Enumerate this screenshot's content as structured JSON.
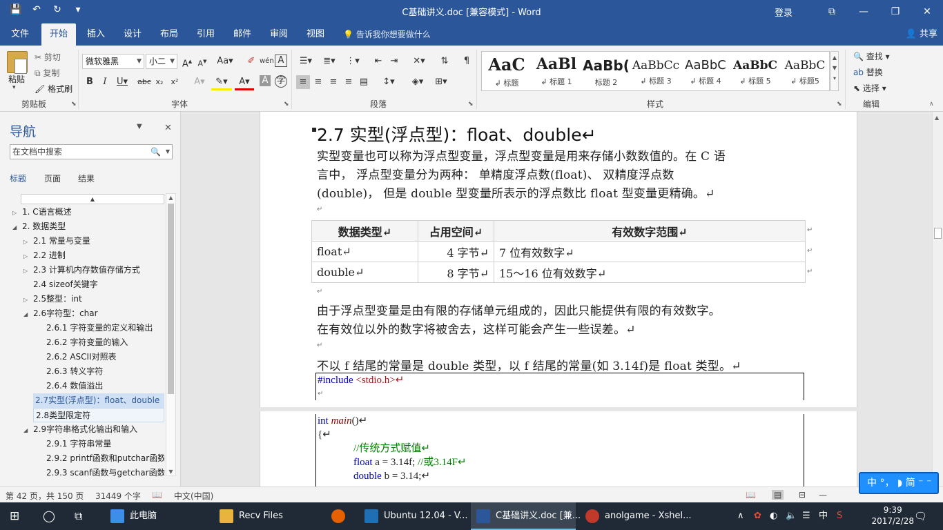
{
  "window": {
    "title": "C基础讲义.doc [兼容模式]  -  Word",
    "login": "登录",
    "restore_icon": "⧉",
    "minimize_icon": "—",
    "maximize_icon": "❐",
    "close_icon": "✕"
  },
  "qat": {
    "save": "💾",
    "undo": "↶",
    "redo": "↻",
    "customize": "▾"
  },
  "tabs": [
    "文件",
    "开始",
    "插入",
    "设计",
    "布局",
    "引用",
    "邮件",
    "审阅",
    "视图"
  ],
  "tell_me": "告诉我你想要做什么",
  "share": "共享",
  "clipboard": {
    "paste": "粘贴",
    "cut": "剪切",
    "copy": "复制",
    "format_painter": "格式刷",
    "label": "剪贴板"
  },
  "font": {
    "name": "微软雅黑",
    "size": "小二",
    "label": "字体"
  },
  "paragraph": {
    "label": "段落"
  },
  "styles": {
    "label": "样式",
    "items": [
      {
        "preview": "AaC",
        "name": "↲ 标题"
      },
      {
        "preview": "AaBl",
        "name": "↲ 标题 1"
      },
      {
        "preview": "AaBb(",
        "name": "标题 2"
      },
      {
        "preview": "AaBbCc",
        "name": "↲ 标题 3"
      },
      {
        "preview": "AaBbC",
        "name": "↲ 标题 4"
      },
      {
        "preview": "AaBbC",
        "name": "↲ 标题 5"
      },
      {
        "preview": "AaBbC",
        "name": "↲ 标题5"
      }
    ]
  },
  "editing": {
    "find": "查找",
    "replace": "替换",
    "select": "选择",
    "label": "编辑"
  },
  "nav": {
    "title": "导航",
    "search_placeholder": "在文档中搜索",
    "tabs": [
      "标题",
      "页面",
      "结果"
    ],
    "items": [
      {
        "text": "1.  C语言概述",
        "tri": "▷"
      },
      {
        "text": "2. 数据类型",
        "tri": "◢"
      },
      {
        "text": "2.1 常量与变量",
        "tri": "▷"
      },
      {
        "text": "2.2 进制",
        "tri": "▷"
      },
      {
        "text": "2.3 计算机内存数值存储方式",
        "tri": "▷"
      },
      {
        "text": "2.4 sizeof关键字",
        "tri": ""
      },
      {
        "text": "2.5整型：int",
        "tri": "▷"
      },
      {
        "text": "2.6字符型：char",
        "tri": "◢"
      },
      {
        "text": "2.6.1 字符变量的定义和输出",
        "tri": ""
      },
      {
        "text": "2.6.2 字符变量的输入",
        "tri": ""
      },
      {
        "text": "2.6.2 ASCII对照表",
        "tri": ""
      },
      {
        "text": "2.6.3 转义字符",
        "tri": ""
      },
      {
        "text": "2.6.4 数值溢出",
        "tri": ""
      },
      {
        "text": "2.7实型(浮点型)：float、double",
        "tri": ""
      },
      {
        "text": "2.8类型限定符",
        "tri": ""
      },
      {
        "text": "2.9字符串格式化输出和输入",
        "tri": "◢"
      },
      {
        "text": "2.9.1 字符串常量",
        "tri": ""
      },
      {
        "text": "2.9.2 printf函数和putchar函数",
        "tri": ""
      },
      {
        "text": "2.9.3 scanf函数与getchar函数",
        "tri": ""
      }
    ]
  },
  "doc": {
    "heading": "2.7 实型(浮点型)：float、double↵",
    "p1": [
      "实型变量也可以称为浮点型变量，浮点型变量是用来存储小数数值的。在 C 语",
      "言中， 浮点型变量分为两种： 单精度浮点数(float)、 双精度浮点数",
      "(double)， 但是 double 型变量所表示的浮点数比 float 型变量更精确。↵"
    ],
    "table": {
      "headers": [
        "数据类型↵",
        "占用空间↵",
        "有效数字范围↵"
      ],
      "rows": [
        [
          "float↵",
          "4 字节↵",
          "7 位有效数字↵"
        ],
        [
          "double↵",
          "8 字节↵",
          "15～16 位有效数字↵"
        ]
      ]
    },
    "p2": [
      "由于浮点型变量是由有限的存储单元组成的，因此只能提供有限的有效数字。",
      "在有效位以外的数字将被舍去，这样可能会产生一些误差。↵"
    ],
    "p3": "不以 f 结尾的常量是 double 类型，以 f 结尾的常量(如 3.14f)是 float 类型。↵",
    "code1": {
      "include": "#include ",
      "header": "<stdio.h>↵"
    },
    "code2": {
      "int": "int ",
      "main": "main",
      "paren": "()↵",
      "brace": "{↵",
      "comment": "//传统方式赋值↵",
      "l3_kw": "float ",
      "l3_rest": "a = 3.14f; ",
      "l3_cm": "//或3.14F↵",
      "l4_kw": "double ",
      "l4_rest": "b = 3.14;↵"
    },
    "para_mark": "↵"
  },
  "status": {
    "page": "第 42 页，共 150 页",
    "words": "31449 个字",
    "lang": "中文(中国)"
  },
  "ime": "中 °， ◗ 简 ⁻ ⁻",
  "taskbar": {
    "items": [
      "此电脑",
      "Recv Files",
      "Ubuntu 12.04 - V...",
      "C基础讲义.doc [兼...",
      "anolgame - Xshel..."
    ],
    "time": "9:39",
    "date": "2017/2/28",
    "ime_cn": "中"
  }
}
